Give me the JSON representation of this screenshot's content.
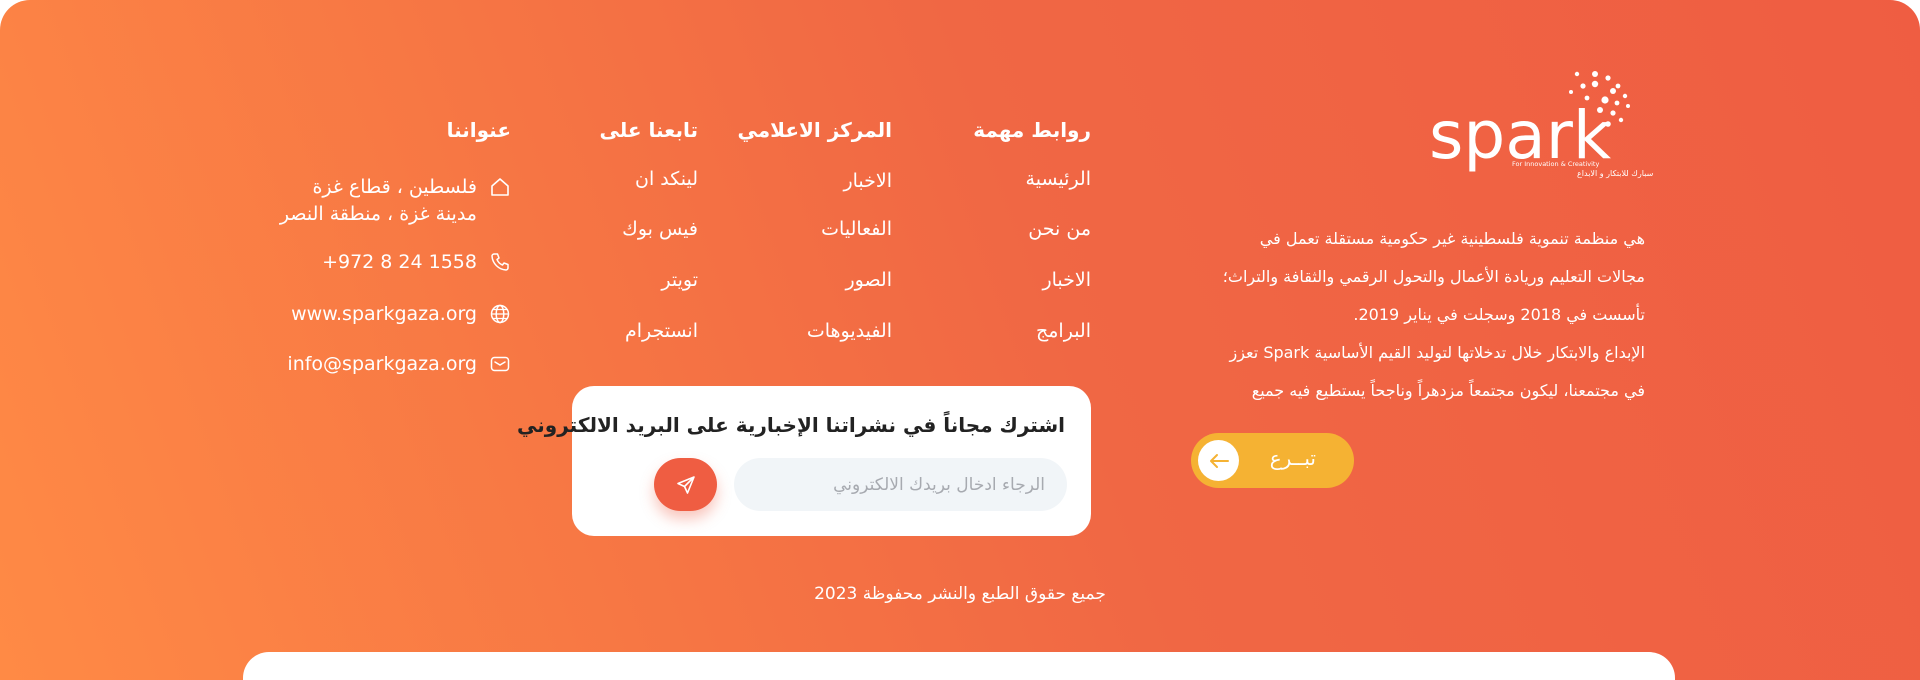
{
  "brand": {
    "logo_text": "spark",
    "logo_tagline_en": "For Innovation & Creativity",
    "logo_tagline_ar": "سبارك للابتكار و الابداع",
    "about_lines": [
      "هي منظمة تنموية فلسطينية غير حكومية مستقلة تعمل في",
      "مجالات التعليم وريادة الأعمال والتحول الرقمي والثقافة والتراث؛",
      "تأسست في 2018 وسجلت في يناير 2019.",
      "الإبداع والابتكار خلال تدخلاتها لتوليد القيم الأساسية Spark تعزز",
      "في مجتمعنا، ليكون مجتمعاً مزدهراً وناجحاً يستطيع فيه جميع"
    ],
    "donate_label": "تبــرع"
  },
  "columns": {
    "links": {
      "title": "روابط مهمة",
      "items": [
        "الرئيسية",
        "من نحن",
        "الاخبار",
        "البرامج"
      ]
    },
    "media": {
      "title": "المركز الاعلامي",
      "items": [
        "الاخبار",
        "الفعاليات",
        "الصور",
        "الفيديوهات"
      ]
    },
    "follow": {
      "title": "تابعنا على",
      "items": [
        "لينكد ان",
        "فيس بوك",
        "تويتر",
        "انستجرام"
      ]
    },
    "contact": {
      "title": "عنواننا",
      "address_line1": "فلسطين ، قطاع غزة",
      "address_line2": "مدينة غزة ، منطقة النصر",
      "phone": "+972 8 24 1558",
      "website": "www.sparkgaza.org",
      "email": "info@sparkgaza.org"
    }
  },
  "newsletter": {
    "title": "اشترك مجاناً في نشراتنا الإخبارية على البريد الالكتروني",
    "placeholder": "الرجاء ادخال بريدك الالكتروني",
    "value": ""
  },
  "footer": {
    "copyright": "جميع حقوق الطبع والنشر محفوظة 2023"
  },
  "colors": {
    "gradient_start": "#ef5d42",
    "gradient_end": "#ff8a45",
    "donate": "#f5b233",
    "send_button": "#ef5d42"
  }
}
